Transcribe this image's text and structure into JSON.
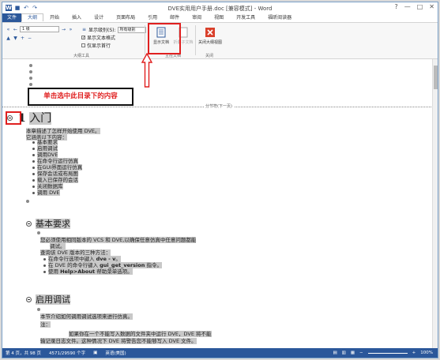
{
  "window": {
    "title": "DVE实用用户手册.doc [兼容模式] - Word"
  },
  "tabs": [
    "文件",
    "大纲",
    "开始",
    "插入",
    "设计",
    "页面布局",
    "引用",
    "邮件",
    "审阅",
    "视图",
    "开发工具",
    "福昕阅读器"
  ],
  "ribbon": {
    "level_value": "1 级",
    "show_level_label": "显示级别(S):",
    "show_level_value": "所有级别",
    "show_text_format": "显示文本格式",
    "show_first_line": "仅显示首行",
    "outline_tools_label": "大纲工具",
    "show_document": "显示文档",
    "collapse_subdocs": "折叠子文档",
    "master_doc_label": "主控文档",
    "close_outline": "关闭大纲视图",
    "close_label": "关闭"
  },
  "annotation": {
    "callout": "单击选中此目录下的内容"
  },
  "document": {
    "section_break": "分节符(下一页)",
    "h1_number": "1",
    "h1_title": "入门",
    "intro_1": "本章描述了怎样开始使用 DVE。",
    "intro_2": "它涵盖以下内容：",
    "bullets": [
      "基本要求",
      "启用调试",
      "调用DVE",
      "在命令行运行仿真",
      "在GUI界面运行仿真",
      "保存会话或布局图",
      "载入已保存的会话",
      "关闭数据库",
      "调用 DVE"
    ],
    "h2_1": "基本要求",
    "req_1": "您必须使用相同版本的 VCS 和 DVE,以确保任意仿真中任意问题都能",
    "req_2": "调试。",
    "req_3": "查询该 DVE 版本的三种方法：",
    "req_sub_1a": "在命令行选项中键入 ",
    "req_sub_1b": "dve - v",
    "req_sub_1c": "。",
    "req_sub_2a": "在 DVE 的命令行键入 ",
    "req_sub_2b": "gui_get_version",
    "req_sub_2c": " 指令。",
    "req_sub_3a": "使用 ",
    "req_sub_3b": "Help>About",
    "req_sub_3c": " 帮助菜单选项。",
    "h2_2": "启用调试",
    "debug_1": "本节介绍如何调用调试选项来进行仿真。",
    "debug_2": "注：",
    "debug_3": "如果你在一个不能写入数据的文件夹中运行 DVE，DVE 将不能",
    "debug_4": "输记录日志文件。这种情况下 DVE 将警告您不能够写入 DVE 文件。"
  },
  "status": {
    "page": "第 4 页，共 98 页",
    "words": "4571/29590 个字",
    "lang": "英语(美国)",
    "zoom": "100%"
  }
}
